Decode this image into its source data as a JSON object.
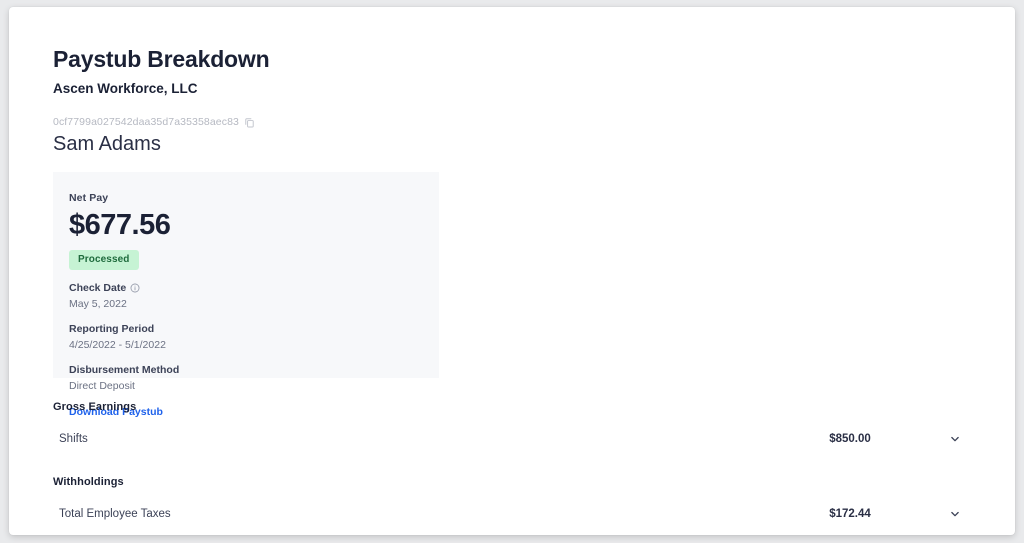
{
  "header": {
    "title": "Paystub Breakdown",
    "company": "Ascen Workforce, LLC",
    "paystub_id": "0cf7799a027542daa35d7a35358aec83",
    "copy_icon": "copy-icon",
    "employee_name": "Sam Adams"
  },
  "net_pay_card": {
    "label": "Net Pay",
    "amount": "$677.56",
    "status": "Processed",
    "status_bg": "#c6f3d4",
    "status_text_color": "#1f6b3d",
    "check_date_label": "Check Date",
    "check_date_info_icon": "info-circle-icon",
    "check_date_value": "May 5, 2022",
    "reporting_period_label": "Reporting Period",
    "reporting_period_value": "4/25/2022 - 5/1/2022",
    "disbursement_label": "Disbursement Method",
    "disbursement_value": "Direct Deposit",
    "download_link": "Download Paystub",
    "link_color": "#1f62eb",
    "card_bg": "#f7f8fa"
  },
  "gross_earnings": {
    "title": "Gross Earnings",
    "rows": [
      {
        "label": "Shifts",
        "amount": "$850.00",
        "chevron_icon": "chevron-down-icon"
      }
    ]
  },
  "withholdings": {
    "title": "Withholdings",
    "rows": [
      {
        "label": "Total Employee Taxes",
        "amount": "$172.44",
        "chevron_icon": "chevron-down-icon"
      }
    ]
  }
}
